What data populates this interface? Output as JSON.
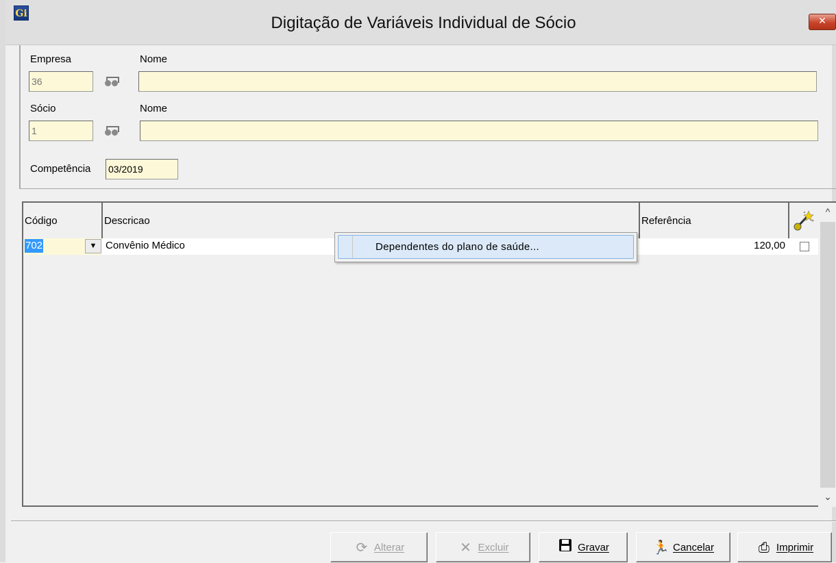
{
  "window": {
    "title": "Digitação de Variáveis Individual de Sócio",
    "app_icon": "Gi",
    "close_glyph": "✕"
  },
  "form": {
    "empresa_label": "Empresa",
    "empresa_value": "36",
    "empresa_nome_label": "Nome",
    "empresa_nome_value": "",
    "socio_label": "Sócio",
    "socio_value": "1",
    "socio_nome_label": "Nome",
    "socio_nome_value": "",
    "competencia_label": "Competência",
    "competencia_value": "03/2019"
  },
  "grid": {
    "columns": [
      "Código",
      "Descricao",
      "Referência"
    ],
    "rows": [
      {
        "codigo": "702",
        "descricao": "Convênio Médico",
        "referencia": "120,00",
        "checked": false
      }
    ]
  },
  "context_menu": {
    "items": [
      "Dependentes do plano de saúde..."
    ]
  },
  "toolbar": {
    "alterar": "Alterar",
    "excluir": "Excluir",
    "gravar": "Gravar",
    "cancelar": "Cancelar",
    "imprimir": "Imprimir"
  },
  "icons": {
    "search": "binoculars-icon",
    "column_tool": "magic-wand-icon",
    "alterar": "refresh-icon",
    "excluir": "delete-x-icon",
    "gravar": "floppy-disk-icon",
    "cancelar": "running-man-icon",
    "imprimir": "printer-icon"
  },
  "colors": {
    "field_bg": "#fdf9d8",
    "selection": "#3399ff",
    "menu_highlight": "#dbe9f8"
  }
}
